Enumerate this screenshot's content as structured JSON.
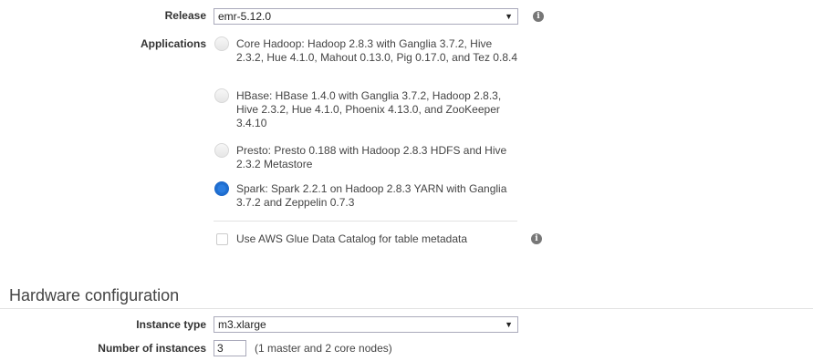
{
  "software": {
    "release_label": "Release",
    "release_value": "emr-5.12.0",
    "applications_label": "Applications",
    "applications": [
      {
        "label": "Core Hadoop: Hadoop 2.8.3 with Ganglia 3.7.2, Hive 2.3.2, Hue 4.1.0, Mahout 0.13.0, Pig 0.17.0, and Tez 0.8.4",
        "selected": false
      },
      {
        "label": "HBase: HBase 1.4.0 with Ganglia 3.7.2, Hadoop 2.8.3, Hive 2.3.2, Hue 4.1.0, Phoenix 4.13.0, and ZooKeeper 3.4.10",
        "selected": false
      },
      {
        "label": "Presto: Presto 0.188 with Hadoop 2.8.3 HDFS and Hive 2.3.2 Metastore",
        "selected": false
      },
      {
        "label": "Spark: Spark 2.2.1 on Hadoop 2.8.3 YARN with Ganglia 3.7.2 and Zeppelin 0.7.3",
        "selected": true
      }
    ],
    "glue_label": "Use AWS Glue Data Catalog for table metadata",
    "glue_checked": false,
    "info_glyph": "i"
  },
  "hardware": {
    "title": "Hardware configuration",
    "instance_type_label": "Instance type",
    "instance_type_value": "m3.xlarge",
    "num_instances_label": "Number of instances",
    "num_instances_value": "3",
    "num_instances_note": "(1 master and 2 core nodes)"
  },
  "icons": {
    "dropdown": "▼"
  },
  "colors": {
    "radio_selected": "#1f6fd0",
    "info_icon": "#777777"
  }
}
